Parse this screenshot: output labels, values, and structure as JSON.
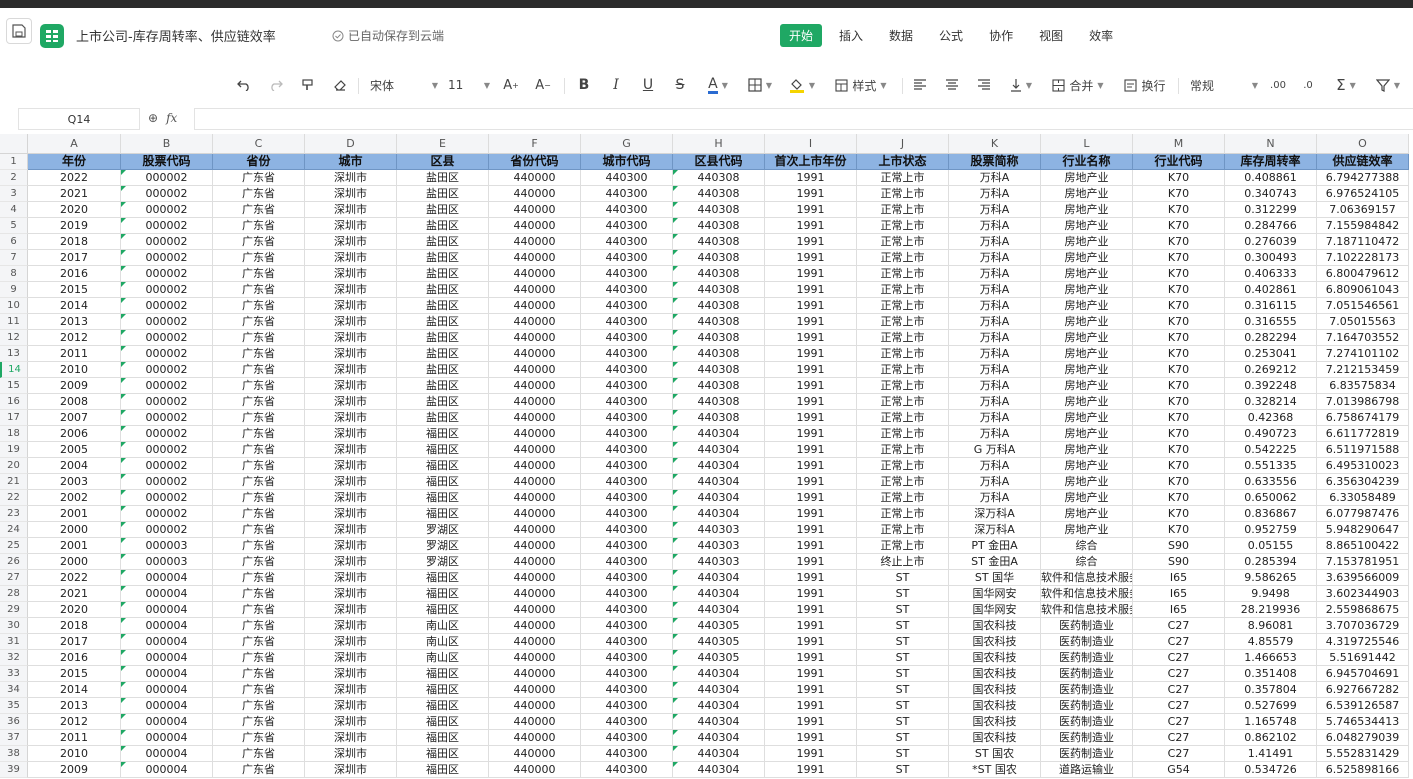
{
  "app": {
    "title": "上市公司-库存周转率、供应链效率",
    "autosave": "已自动保存到云端",
    "menu": [
      "开始",
      "插入",
      "数据",
      "公式",
      "协作",
      "视图",
      "效率"
    ],
    "active_menu": "开始",
    "accent_color": "#1fa864",
    "header_fill_color": "#8db3e2"
  },
  "toolbar": {
    "font_name": "宋体",
    "font_size": "11",
    "style_label": "样式",
    "merge_label": "合并",
    "wrap_label": "换行",
    "number_format": "常规",
    "icons": [
      "undo-icon",
      "redo-icon",
      "format-painter-icon",
      "eraser-icon",
      "bold-icon",
      "italic-icon",
      "underline-icon",
      "strikethrough-icon",
      "font-color-icon",
      "border-icon",
      "fill-color-icon",
      "align-left-icon",
      "align-center-icon",
      "align-right-icon",
      "valign-icon",
      "sum-icon",
      "filter-icon"
    ]
  },
  "formula_bar": {
    "name_box": "Q14",
    "formula": ""
  },
  "sheet": {
    "column_letters": [
      "A",
      "B",
      "C",
      "D",
      "E",
      "F",
      "G",
      "H",
      "I",
      "J",
      "K",
      "L",
      "M",
      "N",
      "O"
    ],
    "headers": [
      "年份",
      "股票代码",
      "省份",
      "城市",
      "区县",
      "省份代码",
      "城市代码",
      "区县代码",
      "首次上市年份",
      "上市状态",
      "股票简称",
      "行业名称",
      "行业代码",
      "库存周转率",
      "供应链效率"
    ],
    "selected_row": 14,
    "rows": [
      [
        "2022",
        "000002",
        "广东省",
        "深圳市",
        "盐田区",
        "440000",
        "440300",
        "440308",
        "1991",
        "正常上市",
        "万科A",
        "房地产业",
        "K70",
        "0.408861",
        "6.794277388"
      ],
      [
        "2021",
        "000002",
        "广东省",
        "深圳市",
        "盐田区",
        "440000",
        "440300",
        "440308",
        "1991",
        "正常上市",
        "万科A",
        "房地产业",
        "K70",
        "0.340743",
        "6.976524105"
      ],
      [
        "2020",
        "000002",
        "广东省",
        "深圳市",
        "盐田区",
        "440000",
        "440300",
        "440308",
        "1991",
        "正常上市",
        "万科A",
        "房地产业",
        "K70",
        "0.312299",
        "7.06369157"
      ],
      [
        "2019",
        "000002",
        "广东省",
        "深圳市",
        "盐田区",
        "440000",
        "440300",
        "440308",
        "1991",
        "正常上市",
        "万科A",
        "房地产业",
        "K70",
        "0.284766",
        "7.155984842"
      ],
      [
        "2018",
        "000002",
        "广东省",
        "深圳市",
        "盐田区",
        "440000",
        "440300",
        "440308",
        "1991",
        "正常上市",
        "万科A",
        "房地产业",
        "K70",
        "0.276039",
        "7.187110472"
      ],
      [
        "2017",
        "000002",
        "广东省",
        "深圳市",
        "盐田区",
        "440000",
        "440300",
        "440308",
        "1991",
        "正常上市",
        "万科A",
        "房地产业",
        "K70",
        "0.300493",
        "7.102228173"
      ],
      [
        "2016",
        "000002",
        "广东省",
        "深圳市",
        "盐田区",
        "440000",
        "440300",
        "440308",
        "1991",
        "正常上市",
        "万科A",
        "房地产业",
        "K70",
        "0.406333",
        "6.800479612"
      ],
      [
        "2015",
        "000002",
        "广东省",
        "深圳市",
        "盐田区",
        "440000",
        "440300",
        "440308",
        "1991",
        "正常上市",
        "万科A",
        "房地产业",
        "K70",
        "0.402861",
        "6.809061043"
      ],
      [
        "2014",
        "000002",
        "广东省",
        "深圳市",
        "盐田区",
        "440000",
        "440300",
        "440308",
        "1991",
        "正常上市",
        "万科A",
        "房地产业",
        "K70",
        "0.316115",
        "7.051546561"
      ],
      [
        "2013",
        "000002",
        "广东省",
        "深圳市",
        "盐田区",
        "440000",
        "440300",
        "440308",
        "1991",
        "正常上市",
        "万科A",
        "房地产业",
        "K70",
        "0.316555",
        "7.05015563"
      ],
      [
        "2012",
        "000002",
        "广东省",
        "深圳市",
        "盐田区",
        "440000",
        "440300",
        "440308",
        "1991",
        "正常上市",
        "万科A",
        "房地产业",
        "K70",
        "0.282294",
        "7.164703552"
      ],
      [
        "2011",
        "000002",
        "广东省",
        "深圳市",
        "盐田区",
        "440000",
        "440300",
        "440308",
        "1991",
        "正常上市",
        "万科A",
        "房地产业",
        "K70",
        "0.253041",
        "7.274101102"
      ],
      [
        "2010",
        "000002",
        "广东省",
        "深圳市",
        "盐田区",
        "440000",
        "440300",
        "440308",
        "1991",
        "正常上市",
        "万科A",
        "房地产业",
        "K70",
        "0.269212",
        "7.212153459"
      ],
      [
        "2009",
        "000002",
        "广东省",
        "深圳市",
        "盐田区",
        "440000",
        "440300",
        "440308",
        "1991",
        "正常上市",
        "万科A",
        "房地产业",
        "K70",
        "0.392248",
        "6.83575834"
      ],
      [
        "2008",
        "000002",
        "广东省",
        "深圳市",
        "盐田区",
        "440000",
        "440300",
        "440308",
        "1991",
        "正常上市",
        "万科A",
        "房地产业",
        "K70",
        "0.328214",
        "7.013986798"
      ],
      [
        "2007",
        "000002",
        "广东省",
        "深圳市",
        "盐田区",
        "440000",
        "440300",
        "440308",
        "1991",
        "正常上市",
        "万科A",
        "房地产业",
        "K70",
        "0.42368",
        "6.758674179"
      ],
      [
        "2006",
        "000002",
        "广东省",
        "深圳市",
        "福田区",
        "440000",
        "440300",
        "440304",
        "1991",
        "正常上市",
        "万科A",
        "房地产业",
        "K70",
        "0.490723",
        "6.611772819"
      ],
      [
        "2005",
        "000002",
        "广东省",
        "深圳市",
        "福田区",
        "440000",
        "440300",
        "440304",
        "1991",
        "正常上市",
        "G 万科A",
        "房地产业",
        "K70",
        "0.542225",
        "6.511971588"
      ],
      [
        "2004",
        "000002",
        "广东省",
        "深圳市",
        "福田区",
        "440000",
        "440300",
        "440304",
        "1991",
        "正常上市",
        "万科A",
        "房地产业",
        "K70",
        "0.551335",
        "6.495310023"
      ],
      [
        "2003",
        "000002",
        "广东省",
        "深圳市",
        "福田区",
        "440000",
        "440300",
        "440304",
        "1991",
        "正常上市",
        "万科A",
        "房地产业",
        "K70",
        "0.633556",
        "6.356304239"
      ],
      [
        "2002",
        "000002",
        "广东省",
        "深圳市",
        "福田区",
        "440000",
        "440300",
        "440304",
        "1991",
        "正常上市",
        "万科A",
        "房地产业",
        "K70",
        "0.650062",
        "6.33058489"
      ],
      [
        "2001",
        "000002",
        "广东省",
        "深圳市",
        "福田区",
        "440000",
        "440300",
        "440304",
        "1991",
        "正常上市",
        "深万科A",
        "房地产业",
        "K70",
        "0.836867",
        "6.077987476"
      ],
      [
        "2000",
        "000002",
        "广东省",
        "深圳市",
        "罗湖区",
        "440000",
        "440300",
        "440303",
        "1991",
        "正常上市",
        "深万科A",
        "房地产业",
        "K70",
        "0.952759",
        "5.948290647"
      ],
      [
        "2001",
        "000003",
        "广东省",
        "深圳市",
        "罗湖区",
        "440000",
        "440300",
        "440303",
        "1991",
        "正常上市",
        "PT 金田A",
        "综合",
        "S90",
        "0.05155",
        "8.865100422"
      ],
      [
        "2000",
        "000003",
        "广东省",
        "深圳市",
        "罗湖区",
        "440000",
        "440300",
        "440303",
        "1991",
        "终止上市",
        "ST 金田A",
        "综合",
        "S90",
        "0.285394",
        "7.153781951"
      ],
      [
        "2022",
        "000004",
        "广东省",
        "深圳市",
        "福田区",
        "440000",
        "440300",
        "440304",
        "1991",
        "ST",
        "ST 国华",
        "软件和信息技术服务业",
        "I65",
        "9.586265",
        "3.639566009"
      ],
      [
        "2021",
        "000004",
        "广东省",
        "深圳市",
        "福田区",
        "440000",
        "440300",
        "440304",
        "1991",
        "ST",
        "国华网安",
        "软件和信息技术服务业",
        "I65",
        "9.9498",
        "3.602344903"
      ],
      [
        "2020",
        "000004",
        "广东省",
        "深圳市",
        "福田区",
        "440000",
        "440300",
        "440304",
        "1991",
        "ST",
        "国华网安",
        "软件和信息技术服务业",
        "I65",
        "28.219936",
        "2.559868675"
      ],
      [
        "2018",
        "000004",
        "广东省",
        "深圳市",
        "南山区",
        "440000",
        "440300",
        "440305",
        "1991",
        "ST",
        "国农科技",
        "医药制造业",
        "C27",
        "8.96081",
        "3.707036729"
      ],
      [
        "2017",
        "000004",
        "广东省",
        "深圳市",
        "南山区",
        "440000",
        "440300",
        "440305",
        "1991",
        "ST",
        "国农科技",
        "医药制造业",
        "C27",
        "4.85579",
        "4.319725546"
      ],
      [
        "2016",
        "000004",
        "广东省",
        "深圳市",
        "南山区",
        "440000",
        "440300",
        "440305",
        "1991",
        "ST",
        "国农科技",
        "医药制造业",
        "C27",
        "1.466653",
        "5.51691442"
      ],
      [
        "2015",
        "000004",
        "广东省",
        "深圳市",
        "福田区",
        "440000",
        "440300",
        "440304",
        "1991",
        "ST",
        "国农科技",
        "医药制造业",
        "C27",
        "0.351408",
        "6.945704691"
      ],
      [
        "2014",
        "000004",
        "广东省",
        "深圳市",
        "福田区",
        "440000",
        "440300",
        "440304",
        "1991",
        "ST",
        "国农科技",
        "医药制造业",
        "C27",
        "0.357804",
        "6.927667282"
      ],
      [
        "2013",
        "000004",
        "广东省",
        "深圳市",
        "福田区",
        "440000",
        "440300",
        "440304",
        "1991",
        "ST",
        "国农科技",
        "医药制造业",
        "C27",
        "0.527699",
        "6.539126587"
      ],
      [
        "2012",
        "000004",
        "广东省",
        "深圳市",
        "福田区",
        "440000",
        "440300",
        "440304",
        "1991",
        "ST",
        "国农科技",
        "医药制造业",
        "C27",
        "1.165748",
        "5.746534413"
      ],
      [
        "2011",
        "000004",
        "广东省",
        "深圳市",
        "福田区",
        "440000",
        "440300",
        "440304",
        "1991",
        "ST",
        "国农科技",
        "医药制造业",
        "C27",
        "0.862102",
        "6.048279039"
      ],
      [
        "2010",
        "000004",
        "广东省",
        "深圳市",
        "福田区",
        "440000",
        "440300",
        "440304",
        "1991",
        "ST",
        "ST 国农",
        "医药制造业",
        "C27",
        "1.41491",
        "5.552831429"
      ],
      [
        "2009",
        "000004",
        "广东省",
        "深圳市",
        "福田区",
        "440000",
        "440300",
        "440304",
        "1991",
        "ST",
        "*ST 国农",
        "道路运输业",
        "G54",
        "0.534726",
        "6.525898166"
      ]
    ]
  }
}
